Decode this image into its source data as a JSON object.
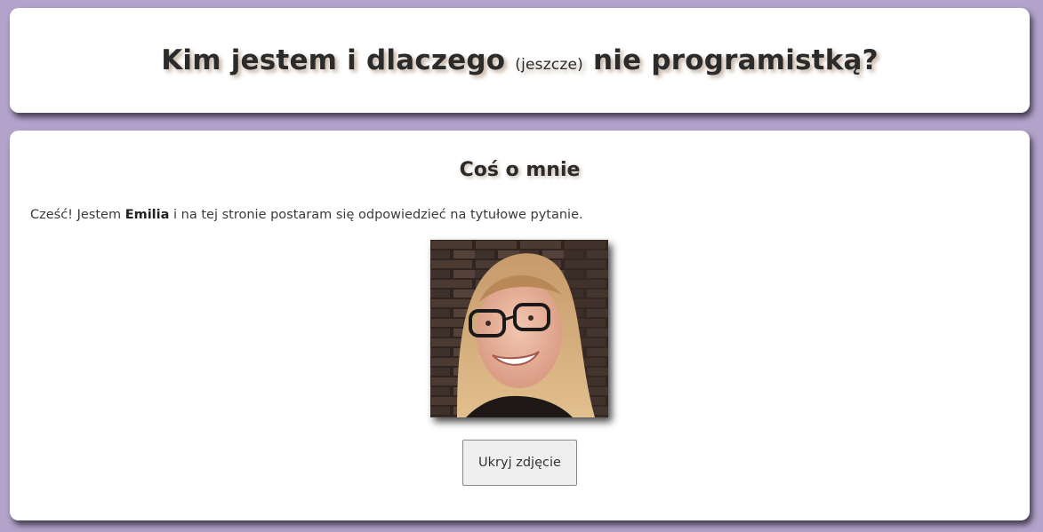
{
  "header": {
    "title_part1": "Kim jestem i dlaczego ",
    "title_small": "(jeszcze)",
    "title_part2": " nie programistką?"
  },
  "about": {
    "heading": "Coś o mnie",
    "intro_before": "Cześć! Jestem ",
    "intro_name": "Emilia",
    "intro_after": " i na tej stronie postaram się odpowiedzieć na tytułowe pytanie.",
    "hide_photo_label": "Ukryj zdjęcie"
  },
  "colors": {
    "page_background": "#b3a3ca",
    "card_background": "#ffffff",
    "button_background": "#efefef"
  }
}
